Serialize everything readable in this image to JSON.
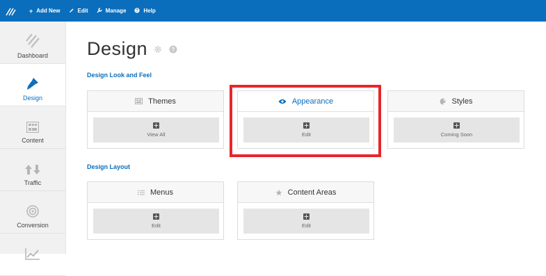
{
  "topbar": {
    "items": [
      {
        "icon": "plus-icon",
        "label": "Add New"
      },
      {
        "icon": "pencil-icon",
        "label": "Edit"
      },
      {
        "icon": "wrench-icon",
        "label": "Manage"
      },
      {
        "icon": "help-icon",
        "label": "Help"
      }
    ]
  },
  "sidebar": {
    "items": [
      {
        "label": "Dashboard",
        "icon": "dashboard-icon"
      },
      {
        "label": "Design",
        "icon": "paintbrush-icon",
        "active": true
      },
      {
        "label": "Content",
        "icon": "content-grid-icon"
      },
      {
        "label": "Traffic",
        "icon": "traffic-arrows-icon"
      },
      {
        "label": "Conversion",
        "icon": "target-icon"
      },
      {
        "label": "",
        "icon": "chart-icon"
      }
    ]
  },
  "page": {
    "title": "Design"
  },
  "sections": {
    "look_and_feel": "Design Look and Feel",
    "layout": "Design Layout"
  },
  "cards": {
    "themes": {
      "title": "Themes",
      "button": "View All"
    },
    "appearance": {
      "title": "Appearance",
      "button": "Edit"
    },
    "styles": {
      "title": "Styles",
      "button": "Coming Soon"
    },
    "menus": {
      "title": "Menus",
      "button": "Edit"
    },
    "content_areas": {
      "title": "Content Areas",
      "button": "Edit"
    }
  },
  "colors": {
    "brand": "#0a6ebd",
    "highlight": "#e8262a"
  }
}
